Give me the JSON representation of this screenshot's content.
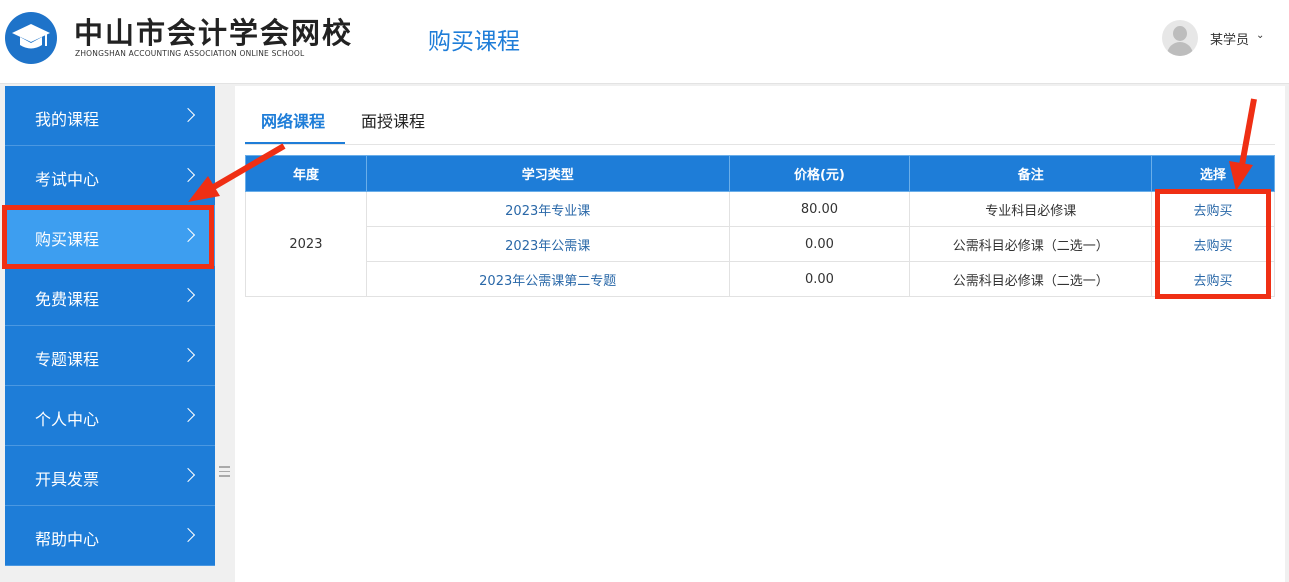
{
  "header": {
    "site_title": "中山市会计学会网校",
    "site_subtitle": "ZHONGSHAN ACCOUNTING ASSOCIATION ONLINE SCHOOL",
    "page_heading": "购买课程",
    "user_name": "某学员",
    "user_caret": "⌄"
  },
  "sidebar": {
    "items": [
      {
        "label": "我的课程"
      },
      {
        "label": "考试中心"
      },
      {
        "label": "购买课程",
        "active": true
      },
      {
        "label": "免费课程"
      },
      {
        "label": "专题课程"
      },
      {
        "label": "个人中心"
      },
      {
        "label": "开具发票"
      },
      {
        "label": "帮助中心"
      }
    ]
  },
  "tabs": [
    {
      "label": "网络课程",
      "active": true
    },
    {
      "label": "面授课程"
    }
  ],
  "table": {
    "headers": [
      "年度",
      "学习类型",
      "价格(元)",
      "备注",
      "选择"
    ],
    "year": "2023",
    "rows": [
      {
        "type": "2023年专业课",
        "price": "80.00",
        "note": "专业科目必修课",
        "action": "去购买"
      },
      {
        "type": "2023年公需课",
        "price": "0.00",
        "note": "公需科目必修课（二选一）",
        "action": "去购买"
      },
      {
        "type": "2023年公需课第二专题",
        "price": "0.00",
        "note": "公需科目必修课（二选一）",
        "action": "去购买"
      }
    ]
  },
  "colors": {
    "primary": "#1e7dd8",
    "sidebar_active": "#3d9ef0",
    "annotation_red": "#ef2f14",
    "link": "#2a68a8"
  },
  "icons": [
    "graduation-cap-icon",
    "avatar-icon",
    "chevron-right-icon",
    "chevron-down-icon",
    "drag-handle-icon",
    "annotation-arrow-icon"
  ]
}
